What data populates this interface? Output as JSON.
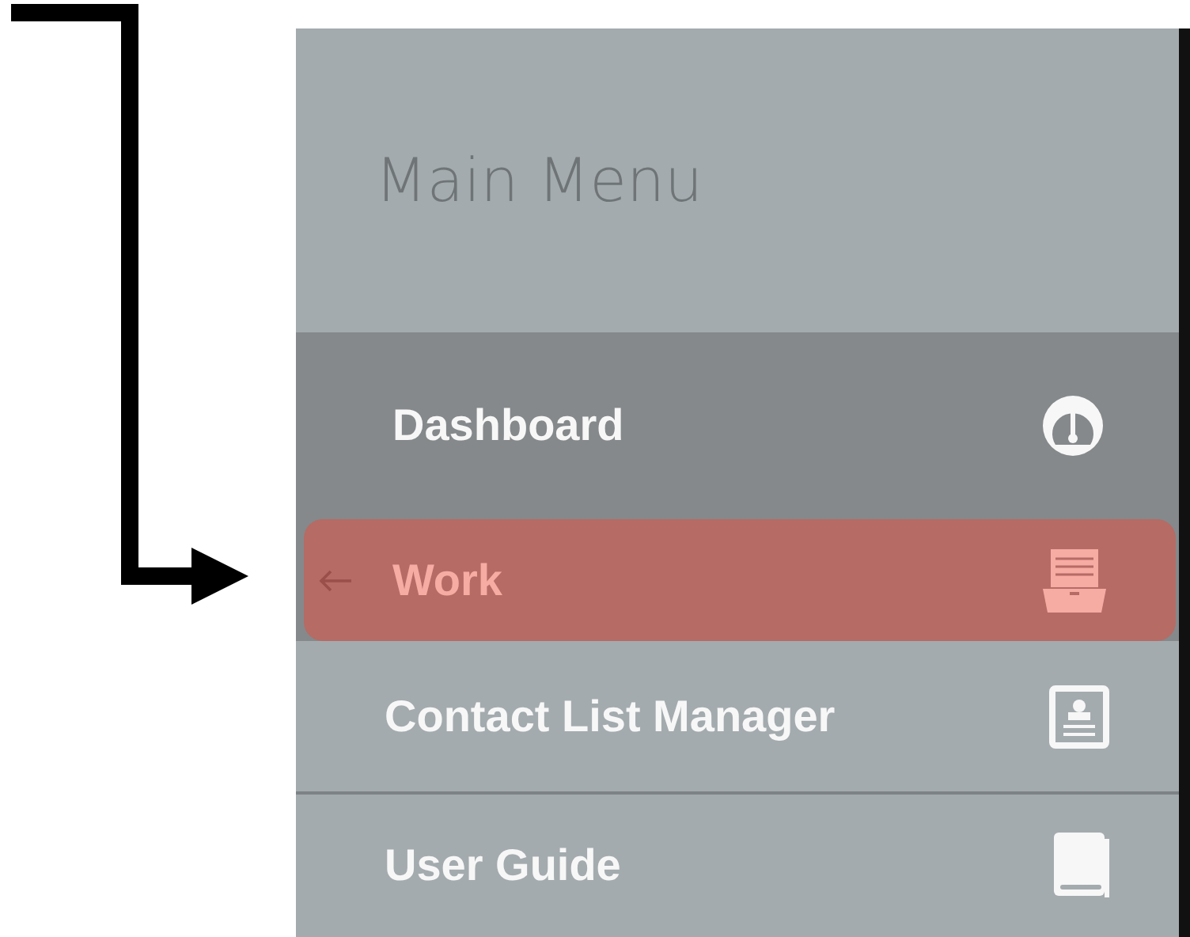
{
  "menu": {
    "title": "Main Menu",
    "items": [
      {
        "label": "Dashboard",
        "active": true,
        "selected": false
      },
      {
        "label": "Work",
        "active": true,
        "selected": true
      },
      {
        "label": "Contact List Manager",
        "active": false,
        "selected": false
      },
      {
        "label": "User Guide",
        "active": false,
        "selected": false
      }
    ]
  }
}
